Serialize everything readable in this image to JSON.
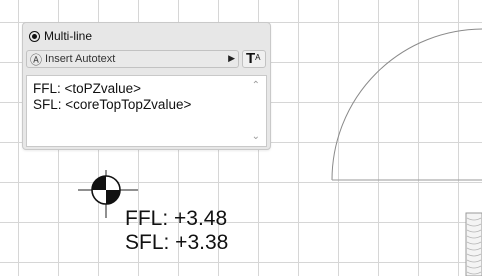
{
  "panel": {
    "mode_label": "Multi-line",
    "insert_autotext_label": "Insert Autotext",
    "text_style_label": "T",
    "text_style_superscript": "A",
    "text_area_content": "FFL: <toPZvalue>\nSFL: <coreTopTopZvalue>"
  },
  "drawing": {
    "label_ffl": "FFL: +3.48",
    "label_sfl": "SFL: +3.38"
  },
  "icons": {
    "autotext": "autotext-icon",
    "submenu_arrow": "triangle-right-icon",
    "scroll_up": "chevron-up-icon",
    "scroll_down": "chevron-down-icon",
    "level_marker": "level-marker-icon"
  },
  "colors": {
    "grid": "#d6d6d6",
    "panel_bg": "#e7e7e7",
    "text": "#111111"
  }
}
